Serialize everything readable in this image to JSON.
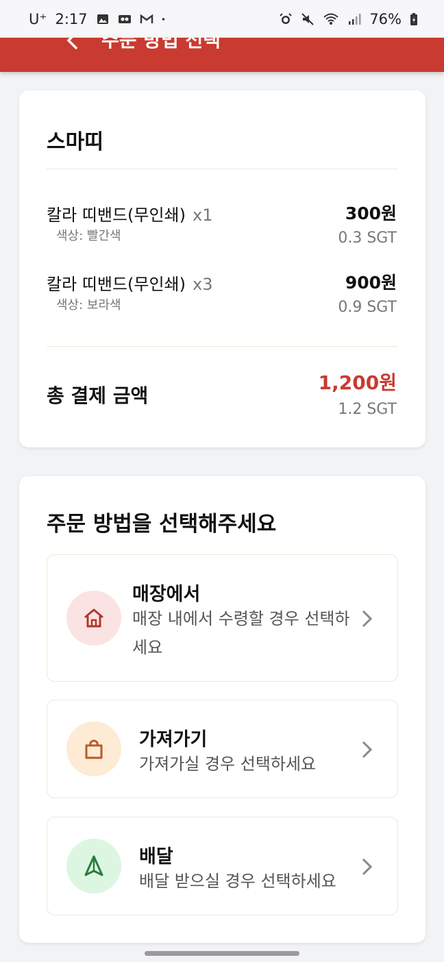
{
  "status_bar": {
    "carrier": "U⁺",
    "time": "2:17",
    "battery": "76%"
  },
  "header": {
    "back_icon": "chevron-left-icon",
    "title": "주문 방법 선택"
  },
  "summary": {
    "store_name": "스마띠",
    "items": [
      {
        "name": "칼라 띠밴드(무인쇄)",
        "qty": "x1",
        "option": "색상: 빨간색",
        "price": "300원",
        "sgt": "0.3 SGT"
      },
      {
        "name": "칼라 띠밴드(무인쇄)",
        "qty": "x3",
        "option": "색상: 보라색",
        "price": "900원",
        "sgt": "0.9 SGT"
      }
    ],
    "total_label": "총 결제 금액",
    "total_price": "1,200원",
    "total_sgt": "1.2 SGT"
  },
  "methods": {
    "title": "주문 방법을 선택해주세요",
    "options": [
      {
        "title": "매장에서",
        "desc": "매장 내에서 수령할 경우 선택하세요",
        "icon": "home-icon",
        "icon_bg": "#fbe3e3",
        "icon_color": "#b3352c"
      },
      {
        "title": "가져가기",
        "desc": "가져가실 경우 선택하세요",
        "icon": "shopping-bag-icon",
        "icon_bg": "#fdebd5",
        "icon_color": "#b85a25"
      },
      {
        "title": "배달",
        "desc": "배달 받으실 경우 선택하세요",
        "icon": "navigation-icon",
        "icon_bg": "#dcf6e2",
        "icon_color": "#2f7a3f"
      }
    ]
  },
  "colors": {
    "brand": "#c93a30",
    "total": "#c93a30"
  }
}
